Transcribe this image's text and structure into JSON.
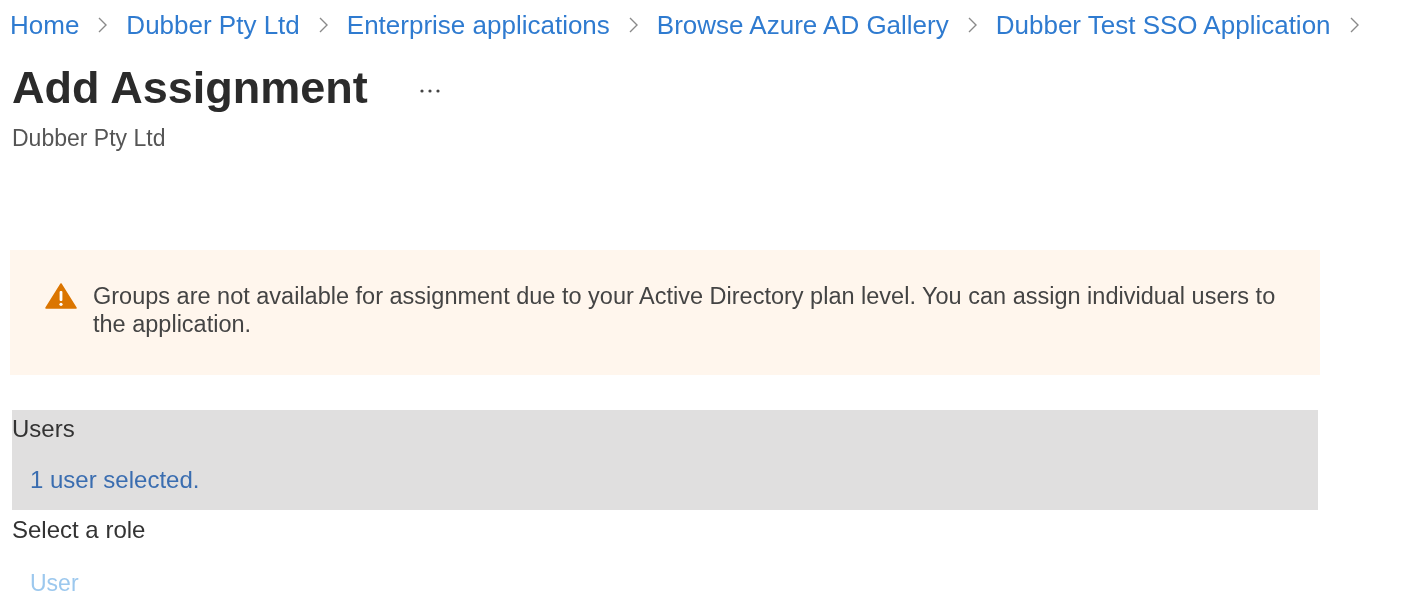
{
  "breadcrumb": [
    "Home",
    "Dubber Pty Ltd",
    "Enterprise applications",
    "Browse Azure AD Gallery",
    "Dubber Test SSO Application"
  ],
  "page": {
    "title": "Add Assignment",
    "subtitle": "Dubber Pty Ltd"
  },
  "alert": {
    "kind": "warning",
    "message": "Groups are not available for assignment due to your Active Directory plan level. You can assign individual users to the application."
  },
  "users": {
    "label": "Users",
    "selection": "1 user selected.",
    "selected": true
  },
  "role": {
    "label": "Select a role",
    "options": [
      {
        "label": "User",
        "disabled": true
      }
    ]
  }
}
